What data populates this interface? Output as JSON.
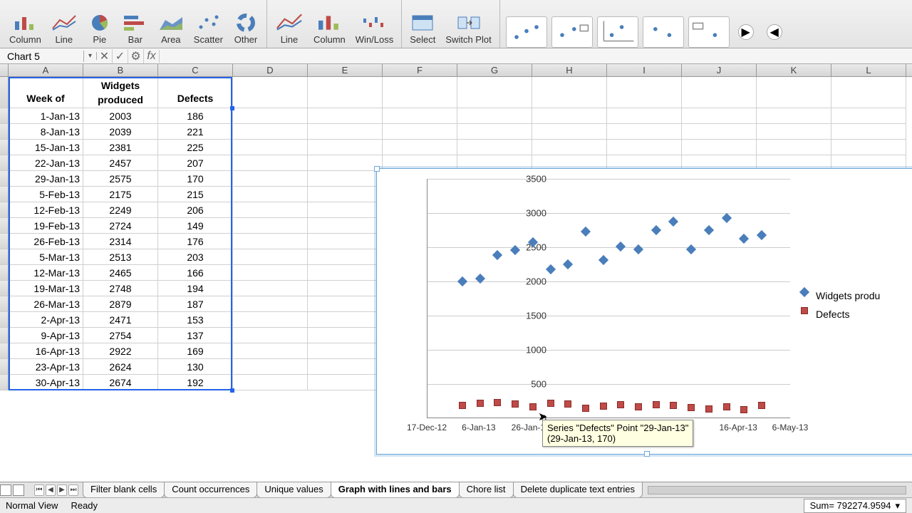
{
  "ribbon": {
    "chart_types": [
      "Column",
      "Line",
      "Pie",
      "Bar",
      "Area",
      "Scatter",
      "Other"
    ],
    "sparklines": [
      "Line",
      "Column",
      "Win/Loss"
    ],
    "data_btns": [
      "Select",
      "Switch Plot"
    ]
  },
  "namebox": "Chart 5",
  "columns": [
    "A",
    "B",
    "C",
    "D",
    "E",
    "F",
    "G",
    "H",
    "I",
    "J",
    "K",
    "L"
  ],
  "headers": {
    "A": "Week of",
    "B": "Widgets produced",
    "C": "Defects"
  },
  "rows": [
    {
      "A": "1-Jan-13",
      "B": "2003",
      "C": "186"
    },
    {
      "A": "8-Jan-13",
      "B": "2039",
      "C": "221"
    },
    {
      "A": "15-Jan-13",
      "B": "2381",
      "C": "225"
    },
    {
      "A": "22-Jan-13",
      "B": "2457",
      "C": "207"
    },
    {
      "A": "29-Jan-13",
      "B": "2575",
      "C": "170"
    },
    {
      "A": "5-Feb-13",
      "B": "2175",
      "C": "215"
    },
    {
      "A": "12-Feb-13",
      "B": "2249",
      "C": "206"
    },
    {
      "A": "19-Feb-13",
      "B": "2724",
      "C": "149"
    },
    {
      "A": "26-Feb-13",
      "B": "2314",
      "C": "176"
    },
    {
      "A": "5-Mar-13",
      "B": "2513",
      "C": "203"
    },
    {
      "A": "12-Mar-13",
      "B": "2465",
      "C": "166"
    },
    {
      "A": "19-Mar-13",
      "B": "2748",
      "C": "194"
    },
    {
      "A": "26-Mar-13",
      "B": "2879",
      "C": "187"
    },
    {
      "A": "2-Apr-13",
      "B": "2471",
      "C": "153"
    },
    {
      "A": "9-Apr-13",
      "B": "2754",
      "C": "137"
    },
    {
      "A": "16-Apr-13",
      "B": "2922",
      "C": "169"
    },
    {
      "A": "23-Apr-13",
      "B": "2624",
      "C": "130"
    },
    {
      "A": "30-Apr-13",
      "B": "2674",
      "C": "192"
    }
  ],
  "chart_data": {
    "type": "scatter",
    "ylim": [
      0,
      3500
    ],
    "ytick": [
      0,
      500,
      1000,
      1500,
      2000,
      2500,
      3000,
      3500
    ],
    "xticks": [
      "17-Dec-12",
      "6-Jan-13",
      "26-Jan-13",
      "",
      "",
      "",
      "16-Apr-13",
      "6-May-13"
    ],
    "series": [
      {
        "name": "Widgets produced",
        "marker": "diamond",
        "color": "#4a7ebb",
        "x": [
          "1-Jan-13",
          "8-Jan-13",
          "15-Jan-13",
          "22-Jan-13",
          "29-Jan-13",
          "5-Feb-13",
          "12-Feb-13",
          "19-Feb-13",
          "26-Feb-13",
          "5-Mar-13",
          "12-Mar-13",
          "19-Mar-13",
          "26-Mar-13",
          "2-Apr-13",
          "9-Apr-13",
          "16-Apr-13",
          "23-Apr-13",
          "30-Apr-13"
        ],
        "y": [
          2003,
          2039,
          2381,
          2457,
          2575,
          2175,
          2249,
          2724,
          2314,
          2513,
          2465,
          2748,
          2879,
          2471,
          2754,
          2922,
          2624,
          2674
        ]
      },
      {
        "name": "Defects",
        "marker": "square",
        "color": "#be4b48",
        "x": [
          "1-Jan-13",
          "8-Jan-13",
          "15-Jan-13",
          "22-Jan-13",
          "29-Jan-13",
          "5-Feb-13",
          "12-Feb-13",
          "19-Feb-13",
          "26-Feb-13",
          "5-Mar-13",
          "12-Mar-13",
          "19-Mar-13",
          "26-Mar-13",
          "2-Apr-13",
          "9-Apr-13",
          "16-Apr-13",
          "23-Apr-13",
          "30-Apr-13"
        ],
        "y": [
          186,
          221,
          225,
          207,
          170,
          215,
          206,
          149,
          176,
          203,
          166,
          194,
          187,
          153,
          137,
          169,
          130,
          192
        ]
      }
    ],
    "legend": [
      "Widgets produ",
      "Defects"
    ],
    "tooltip_line1": "Series \"Defects\" Point \"29-Jan-13\"",
    "tooltip_line2": "(29-Jan-13, 170)"
  },
  "tabs": [
    "Filter blank cells",
    "Count occurrences",
    "Unique values",
    "Graph with lines and bars",
    "Chore list",
    "Delete duplicate text entries"
  ],
  "active_tab": 3,
  "status": {
    "view": "Normal View",
    "state": "Ready",
    "sum": "Sum= 792274.9594"
  }
}
